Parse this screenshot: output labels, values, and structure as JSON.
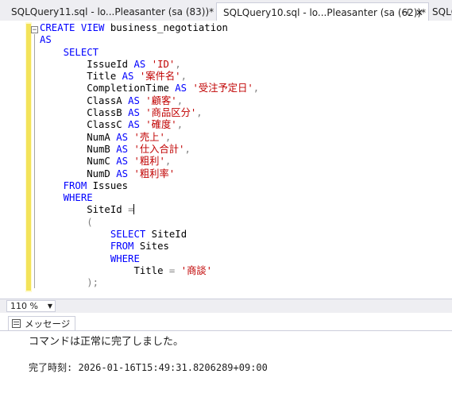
{
  "tabs": [
    {
      "label": "SQLQuery11.sql - lo...Pleasanter (sa (83))*",
      "close": "✕"
    },
    {
      "label": "SQLQuery10.sql - lo...Pleasanter (sa (62))*",
      "pin": "⊣",
      "close": "✕"
    },
    {
      "label": "SQLQ"
    }
  ],
  "editor": {
    "collapse": "−",
    "lines": [
      [
        {
          "t": "CREATE VIEW ",
          "c": "kw"
        },
        {
          "t": "business_negotiation",
          "c": ""
        }
      ],
      [
        {
          "t": "AS",
          "c": "kw"
        }
      ],
      [
        {
          "t": "    SELECT",
          "c": "kw"
        }
      ],
      [
        {
          "t": "        IssueId ",
          "c": ""
        },
        {
          "t": "AS ",
          "c": "kw"
        },
        {
          "t": "'ID'",
          "c": "str"
        },
        {
          "t": ",",
          "c": "gray"
        }
      ],
      [
        {
          "t": "        Title ",
          "c": ""
        },
        {
          "t": "AS ",
          "c": "kw"
        },
        {
          "t": "'案件名'",
          "c": "str"
        },
        {
          "t": ",",
          "c": "gray"
        }
      ],
      [
        {
          "t": "        CompletionTime ",
          "c": ""
        },
        {
          "t": "AS ",
          "c": "kw"
        },
        {
          "t": "'受注予定日'",
          "c": "str"
        },
        {
          "t": ",",
          "c": "gray"
        }
      ],
      [
        {
          "t": "        ClassA ",
          "c": ""
        },
        {
          "t": "AS ",
          "c": "kw"
        },
        {
          "t": "'顧客'",
          "c": "str"
        },
        {
          "t": ",",
          "c": "gray"
        }
      ],
      [
        {
          "t": "        ClassB ",
          "c": ""
        },
        {
          "t": "AS ",
          "c": "kw"
        },
        {
          "t": "'商品区分'",
          "c": "str"
        },
        {
          "t": ",",
          "c": "gray"
        }
      ],
      [
        {
          "t": "        ClassC ",
          "c": ""
        },
        {
          "t": "AS ",
          "c": "kw"
        },
        {
          "t": "'確度'",
          "c": "str"
        },
        {
          "t": ",",
          "c": "gray"
        }
      ],
      [
        {
          "t": "        NumA ",
          "c": ""
        },
        {
          "t": "AS ",
          "c": "kw"
        },
        {
          "t": "'売上'",
          "c": "str"
        },
        {
          "t": ",",
          "c": "gray"
        }
      ],
      [
        {
          "t": "        NumB ",
          "c": ""
        },
        {
          "t": "AS ",
          "c": "kw"
        },
        {
          "t": "'仕入合計'",
          "c": "str"
        },
        {
          "t": ",",
          "c": "gray"
        }
      ],
      [
        {
          "t": "        NumC ",
          "c": ""
        },
        {
          "t": "AS ",
          "c": "kw"
        },
        {
          "t": "'粗利'",
          "c": "str"
        },
        {
          "t": ",",
          "c": "gray"
        }
      ],
      [
        {
          "t": "        NumD ",
          "c": ""
        },
        {
          "t": "AS ",
          "c": "kw"
        },
        {
          "t": "'粗利率'",
          "c": "str"
        }
      ],
      [
        {
          "t": "    FROM ",
          "c": "kw"
        },
        {
          "t": "Issues",
          "c": ""
        }
      ],
      [
        {
          "t": "    WHERE",
          "c": "kw"
        }
      ],
      [
        {
          "t": "        SiteId ",
          "c": ""
        },
        {
          "t": "=",
          "c": "gray"
        }
      ],
      [
        {
          "t": "        (",
          "c": "gray"
        }
      ],
      [
        {
          "t": "            SELECT ",
          "c": "kw"
        },
        {
          "t": "SiteId",
          "c": ""
        }
      ],
      [
        {
          "t": "            FROM ",
          "c": "kw"
        },
        {
          "t": "Sites",
          "c": ""
        }
      ],
      [
        {
          "t": "            WHERE",
          "c": "kw"
        }
      ],
      [
        {
          "t": "                Title ",
          "c": ""
        },
        {
          "t": "= ",
          "c": "gray"
        },
        {
          "t": "'商談'",
          "c": "str"
        }
      ],
      [
        {
          "t": "        );",
          "c": "gray"
        }
      ]
    ]
  },
  "zoom": {
    "value": "110 %",
    "arrow": "▼"
  },
  "results": {
    "tab_label": "メッセージ",
    "message": "コマンドは正常に完了しました。",
    "completion": "完了時刻: 2026-01-16T15:49:31.8206289+09:00"
  }
}
